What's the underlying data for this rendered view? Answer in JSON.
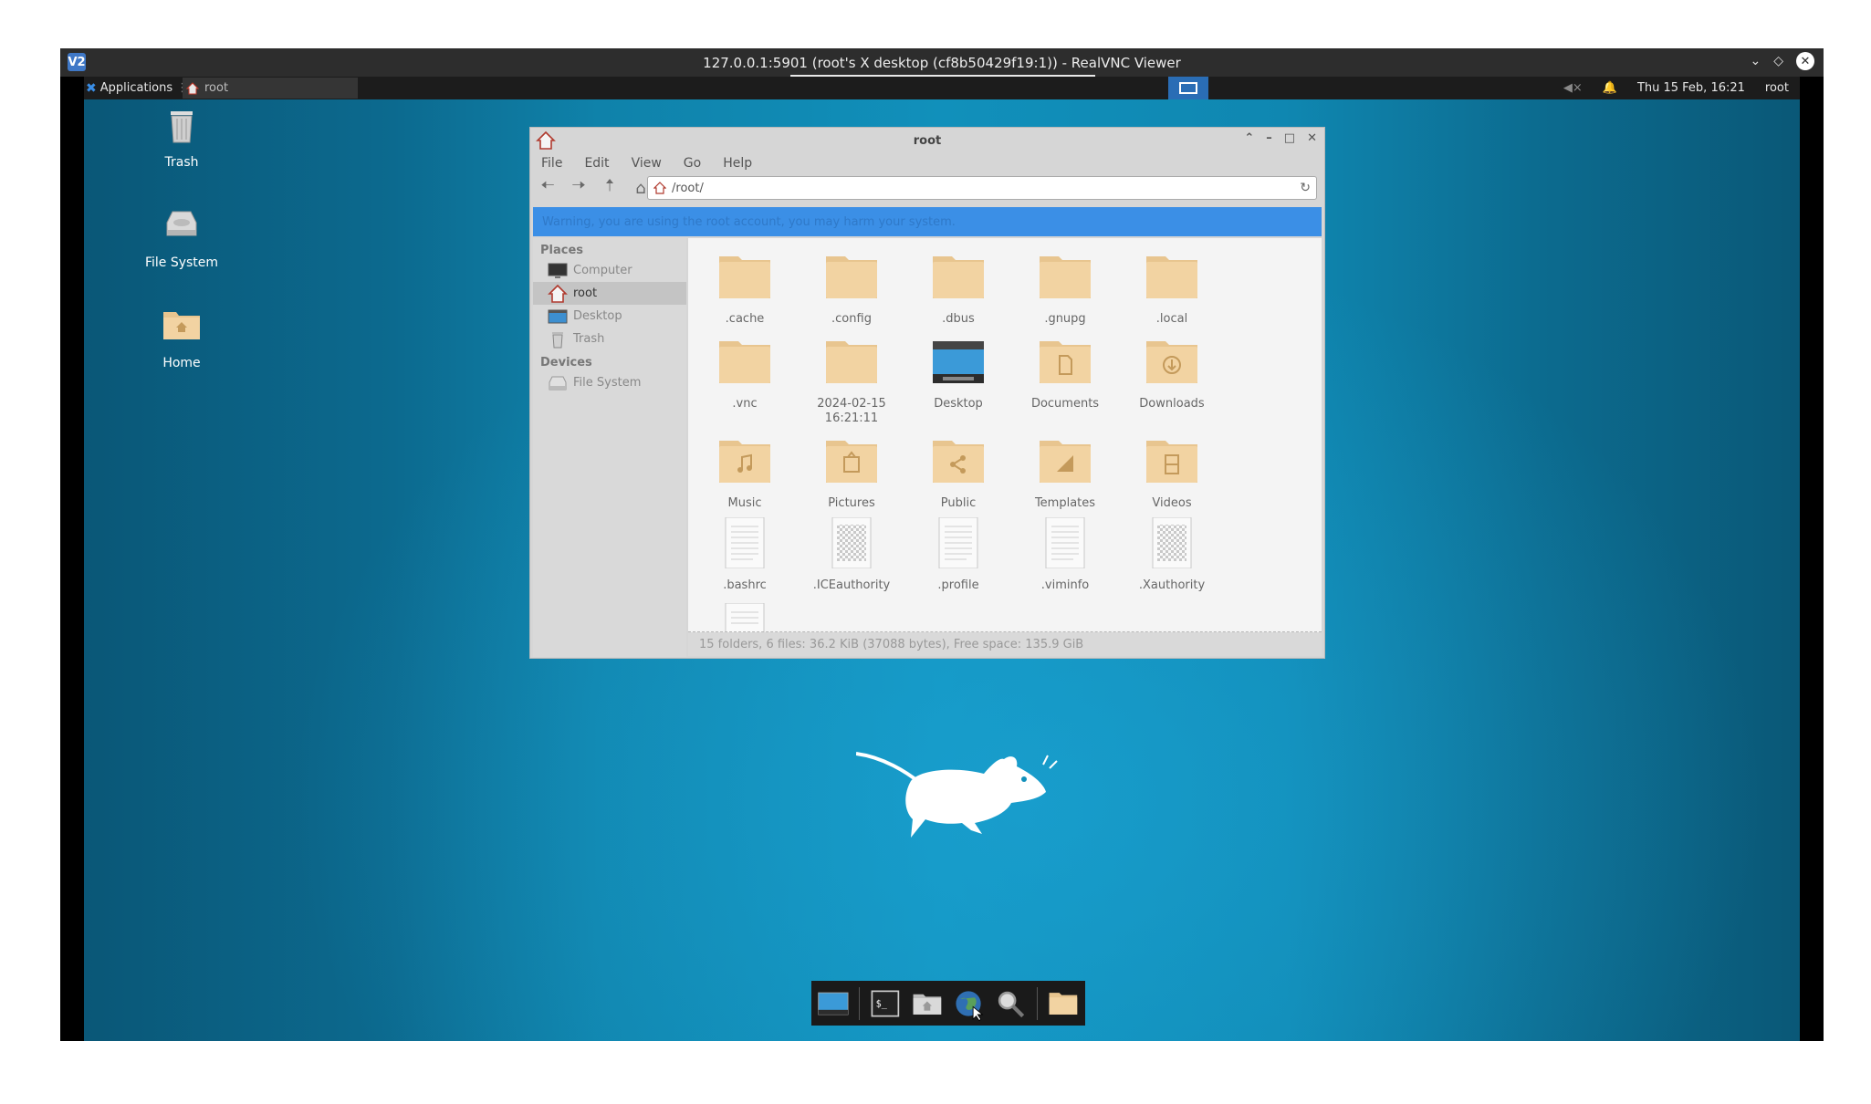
{
  "viewer": {
    "title": "127.0.0.1:5901 (root's X desktop (cf8b50429f19:1)) - RealVNC Viewer",
    "logo": "V2"
  },
  "panel": {
    "applications": "Applications",
    "task_root": "root",
    "datetime": "Thu 15 Feb, 16:21",
    "user": "root"
  },
  "desktop_icons": {
    "trash": "Trash",
    "file_system": "File System",
    "home": "Home"
  },
  "file_manager": {
    "title": "root",
    "menu": {
      "file": "File",
      "edit": "Edit",
      "view": "View",
      "go": "Go",
      "help": "Help"
    },
    "path": "/root/",
    "warning": "Warning, you are using the root account, you may harm your system.",
    "sidebar": {
      "places_label": "Places",
      "devices_label": "Devices",
      "computer": "Computer",
      "root": "root",
      "desktop": "Desktop",
      "trash": "Trash",
      "file_system": "File System"
    },
    "files": {
      "cache": ".cache",
      "config": ".config",
      "dbus": ".dbus",
      "gnupg": ".gnupg",
      "local": ".local",
      "vnc": ".vnc",
      "dated_folder": "2024-02-15\n16:21:11",
      "desktop": "Desktop",
      "documents": "Documents",
      "downloads": "Downloads",
      "music": "Music",
      "pictures": "Pictures",
      "public": "Public",
      "templates": "Templates",
      "videos": "Videos",
      "bashrc": ".bashrc",
      "iceauthority": ".ICEauthority",
      "profile": ".profile",
      "viminfo": ".viminfo",
      "xauthority": ".Xauthority"
    },
    "status": "15 folders, 6 files: 36.2 KiB (37088 bytes), Free space: 135.9 GiB"
  },
  "colors": {
    "accent": "#3b8fe6",
    "folder": "#f2d3a2",
    "panel": "#1c1c1c"
  }
}
